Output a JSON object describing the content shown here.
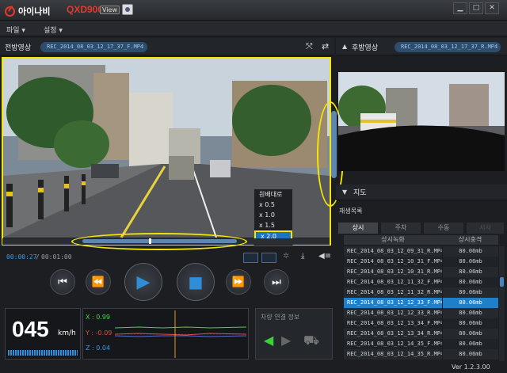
{
  "app": {
    "logo_text": "아이나비",
    "model": "QXD900",
    "view_badge": "View",
    "version": "Ver 1.2.3.00"
  },
  "window": {
    "minimize": "▁",
    "maximize": "□",
    "close": "✕"
  },
  "menu": [
    {
      "label": "파일 ▾"
    },
    {
      "label": "설정 ▾"
    }
  ],
  "front": {
    "label": "전방영상",
    "filename": "REC_2014_08_03_12_17_37_F.MP4"
  },
  "rear": {
    "label": "후방영상",
    "filename": "REC_2014_08_03_12_17_37_R.MP4"
  },
  "speed_menu": {
    "options": [
      "원배대로",
      "x 0.5",
      "x 1.0",
      "x 1.5",
      "x 2.0"
    ],
    "selected": "x 2.0"
  },
  "playback": {
    "current": "00:00:27",
    "separator": "/",
    "total": "00:01:00",
    "progress": 0.45
  },
  "speedometer": {
    "value": "045",
    "unit": "km/h"
  },
  "sensor": {
    "x": "X : 0.99",
    "y": "Y : -0.09",
    "z": "Z : 0.04"
  },
  "vehicle": {
    "title": "차량 연결 정보"
  },
  "map": {
    "label": "지도"
  },
  "playlist": {
    "title": "재생목록",
    "tabs": [
      "상시",
      "주차",
      "수동",
      "시사"
    ],
    "active_tab": "상시",
    "columns": [
      "상시녹화",
      "상시충격"
    ],
    "rows": [
      {
        "name": "REC_2014_08_03_12_09_31_R.MP4",
        "size": "80.06mb"
      },
      {
        "name": "REC_2014_08_03_12_10_31_F.MP4",
        "size": "80.06mb"
      },
      {
        "name": "REC_2014_08_03_12_10_31_R.MP4",
        "size": "80.06mb"
      },
      {
        "name": "REC_2014_08_03_12_11_32_F.MP4",
        "size": "80.06mb"
      },
      {
        "name": "REC_2014_08_03_12_11_32_R.MP4",
        "size": "80.06mb"
      },
      {
        "name": "REC_2014_08_03_12_12_33_F.MP4",
        "size": "80.06mb"
      },
      {
        "name": "REC_2014_08_03_12_12_33_R.MP4",
        "size": "80.06mb"
      },
      {
        "name": "REC_2014_08_03_12_13_34_F.MP4",
        "size": "80.06mb"
      },
      {
        "name": "REC_2014_08_03_12_13_34_R.MP4",
        "size": "80.06mb"
      },
      {
        "name": "REC_2014_08_03_12_14_35_F.MP4",
        "size": "80.06mb"
      },
      {
        "name": "REC_2014_08_03_12_14_35_R.MP4",
        "size": "80.06mb"
      }
    ],
    "selected_index": 5
  },
  "colors": {
    "accent": "#2e8fd8",
    "highlight": "#f3e600",
    "brand": "#e23a2c",
    "selected_row": "#1f7fc8"
  }
}
